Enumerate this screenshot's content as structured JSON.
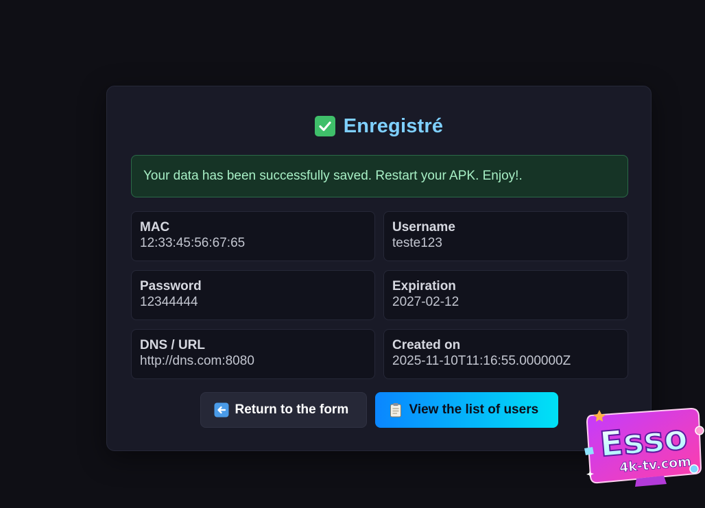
{
  "header": {
    "title": "Enregistré",
    "icon": "check-mark-button-icon"
  },
  "alert": {
    "message": "Your data has been successfully saved. Restart your APK. Enjoy!."
  },
  "fields": [
    {
      "label": "MAC",
      "value": "12:33:45:56:67:65"
    },
    {
      "label": "Username",
      "value": "teste123"
    },
    {
      "label": "Password",
      "value": "12344444"
    },
    {
      "label": "Expiration",
      "value": "2027-02-12"
    },
    {
      "label": "DNS / URL",
      "value": "http://dns.com:8080"
    },
    {
      "label": "Created on",
      "value": "2025-11-10T11:16:55.000000Z"
    }
  ],
  "actions": {
    "return_label": "Return to the form",
    "return_icon": "left-arrow-icon",
    "users_label": "View the list of users",
    "users_icon": "clipboard-icon"
  },
  "logo": {
    "word": "Esso",
    "domain": "4k-tv.com"
  },
  "colors": {
    "page_bg": "#0f0f15",
    "card_bg": "#191a27",
    "title": "#7fd0ff",
    "success_bg": "#163426",
    "success_text": "#a7efc5",
    "primary_gradient_start": "#0a86ff",
    "primary_gradient_end": "#00e1f5"
  }
}
